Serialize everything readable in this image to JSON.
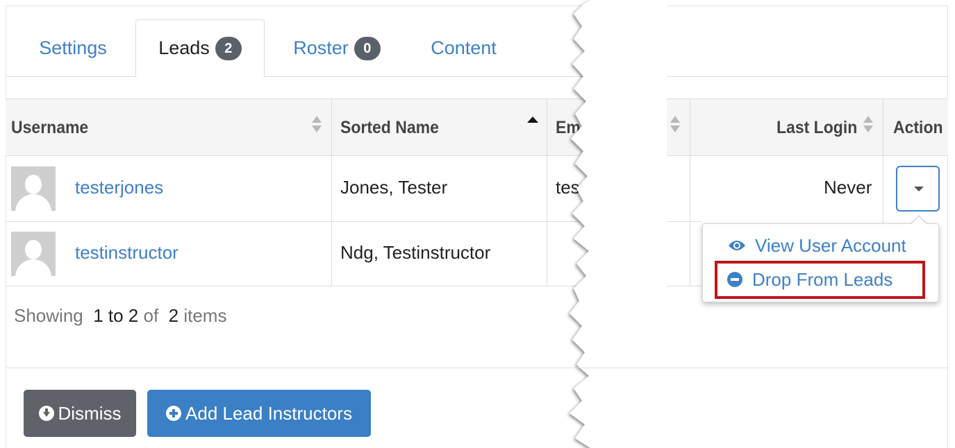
{
  "tabs": [
    {
      "label": "Settings",
      "badge": null
    },
    {
      "label": "Leads",
      "badge": "2"
    },
    {
      "label": "Roster",
      "badge": "0"
    },
    {
      "label": "Content",
      "badge": null
    }
  ],
  "table": {
    "headers": {
      "username": "Username",
      "sorted_name": "Sorted Name",
      "email": "Em",
      "last_login": "Last Login",
      "action": "Action"
    },
    "rows": [
      {
        "username": "testerjones",
        "sorted_name": "Jones, Tester",
        "email": "tes",
        "last_login": "Never"
      },
      {
        "username": "testinstructor",
        "sorted_name": "Ndg, Testinstructor",
        "email": "",
        "last_login": ""
      }
    ]
  },
  "menu": {
    "view_account": "View User Account",
    "drop_from_leads": "Drop From Leads"
  },
  "pagination": {
    "showing": "Showing",
    "range": "1 to 2",
    "of": "of",
    "total": "2",
    "items": "items"
  },
  "buttons": {
    "dismiss": "Dismiss",
    "add_lead": "Add Lead Instructors"
  },
  "colors": {
    "accent": "#3f80c6",
    "badge": "#5b6169",
    "highlight": "#c0141b"
  }
}
